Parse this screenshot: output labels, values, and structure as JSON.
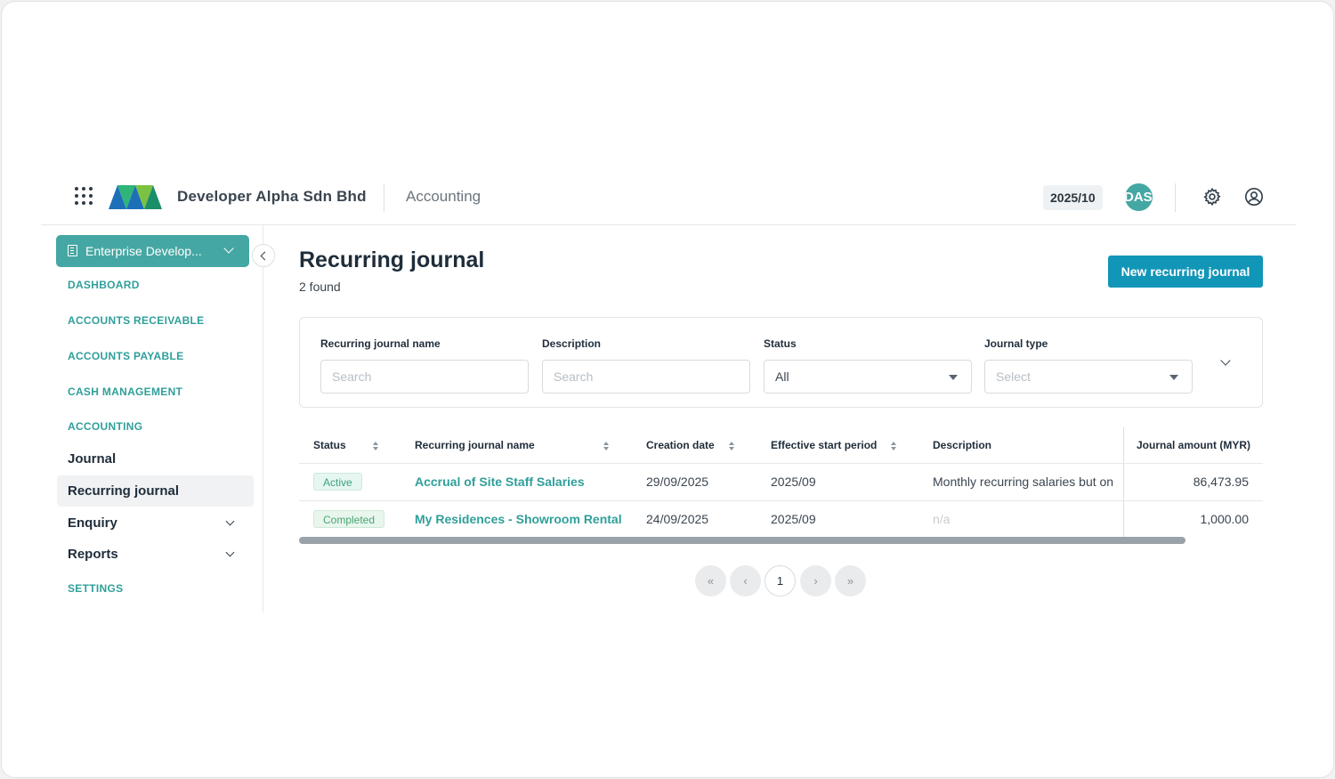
{
  "header": {
    "company": "Developer Alpha Sdn Bhd",
    "module": "Accounting",
    "period": "2025/10",
    "avatar_text": "DASB"
  },
  "sidebar": {
    "entity": "Enterprise Develop...",
    "sections": [
      {
        "label": "DASHBOARD"
      },
      {
        "label": "ACCOUNTS RECEIVABLE"
      },
      {
        "label": "ACCOUNTS PAYABLE"
      },
      {
        "label": "CASH MANAGEMENT"
      },
      {
        "label": "ACCOUNTING"
      },
      {
        "label": "SETTINGS"
      }
    ],
    "items": [
      {
        "label": "Journal"
      },
      {
        "label": "Recurring journal"
      },
      {
        "label": "Enquiry"
      },
      {
        "label": "Reports"
      }
    ]
  },
  "main": {
    "title": "Recurring journal",
    "found": "2 found",
    "new_button": "New recurring journal"
  },
  "filters": {
    "name_label": "Recurring journal name",
    "name_placeholder": "Search",
    "desc_label": "Description",
    "desc_placeholder": "Search",
    "status_label": "Status",
    "status_value": "All",
    "type_label": "Journal type",
    "type_placeholder": "Select"
  },
  "table": {
    "columns": [
      "Status",
      "Recurring journal name",
      "Creation date",
      "Effective start period",
      "Description",
      "Journal amount (MYR)"
    ],
    "rows": [
      {
        "status": "Active",
        "name": "Accrual of Site Staff Salaries",
        "created": "29/09/2025",
        "start_period": "2025/09",
        "description": "Monthly recurring salaries but on",
        "amount": "86,473.95"
      },
      {
        "status": "Completed",
        "name": "My Residences - Showroom Rental",
        "created": "24/09/2025",
        "start_period": "2025/09",
        "description": "n/a",
        "amount": "1,000.00"
      }
    ]
  },
  "pagination": {
    "current": "1",
    "first": "«",
    "prev": "‹",
    "next": "›",
    "last": "»"
  },
  "colors": {
    "brand_teal": "#45a7a3",
    "primary_button": "#1296b8",
    "link_teal": "#2f9f9a"
  }
}
